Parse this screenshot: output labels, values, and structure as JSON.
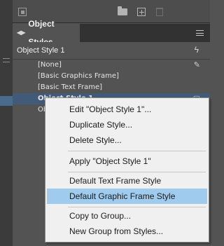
{
  "toolbar": {
    "icons": [
      "stack-icon",
      "folder-icon",
      "new-item-icon",
      "trash-icon"
    ]
  },
  "panel": {
    "tab_label": "Object Styles",
    "current_style": "Object Style 1",
    "styles": [
      {
        "label": "[None]",
        "icon": "no-edit-icon"
      },
      {
        "label": "[Basic Graphics Frame]"
      },
      {
        "label": "[Basic Text Frame]"
      },
      {
        "label": "Object Style 1",
        "selected": true,
        "icon": "shortcut-icon"
      },
      {
        "label": "Ob"
      }
    ]
  },
  "context_menu": {
    "items": [
      {
        "label": "Edit \"Object Style 1\"..."
      },
      {
        "label": "Duplicate Style..."
      },
      {
        "label": "Delete Style..."
      },
      {
        "label": "Apply \"Object Style 1\""
      },
      {
        "label": "Default Text Frame Style"
      },
      {
        "label": "Default Graphic Frame Style",
        "highlighted": true
      },
      {
        "label": "Copy to Group..."
      },
      {
        "label": "New Group from Styles..."
      }
    ]
  },
  "colors": {
    "panel_bg": "#535353",
    "selection": "#415a78",
    "menu_highlight": "#9fcbef"
  }
}
